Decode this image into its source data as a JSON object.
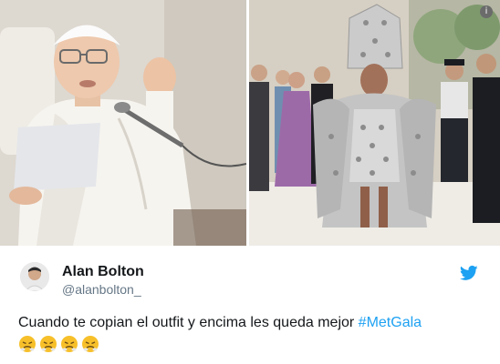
{
  "tweet": {
    "name": "Alan Bolton",
    "handle": "@alanbolton_",
    "text": "Cuando te copian el outfit y encima les queda mejor ",
    "hashtag": "#MetGala",
    "emojis": [
      "face-with-steam-from-nose",
      "face-with-steam-from-nose",
      "face-with-steam-from-nose",
      "face-with-steam-from-nose"
    ]
  },
  "icons": {
    "brand": "twitter-bird-icon",
    "info": "info-icon"
  },
  "colors": {
    "brand": "#1da1f2",
    "name": "#14171a",
    "handle": "#657786"
  },
  "images": {
    "left": "pope-in-white-speaking-at-microphone",
    "right": "woman-in-jeweled-papal-outfit-at-met-gala"
  }
}
